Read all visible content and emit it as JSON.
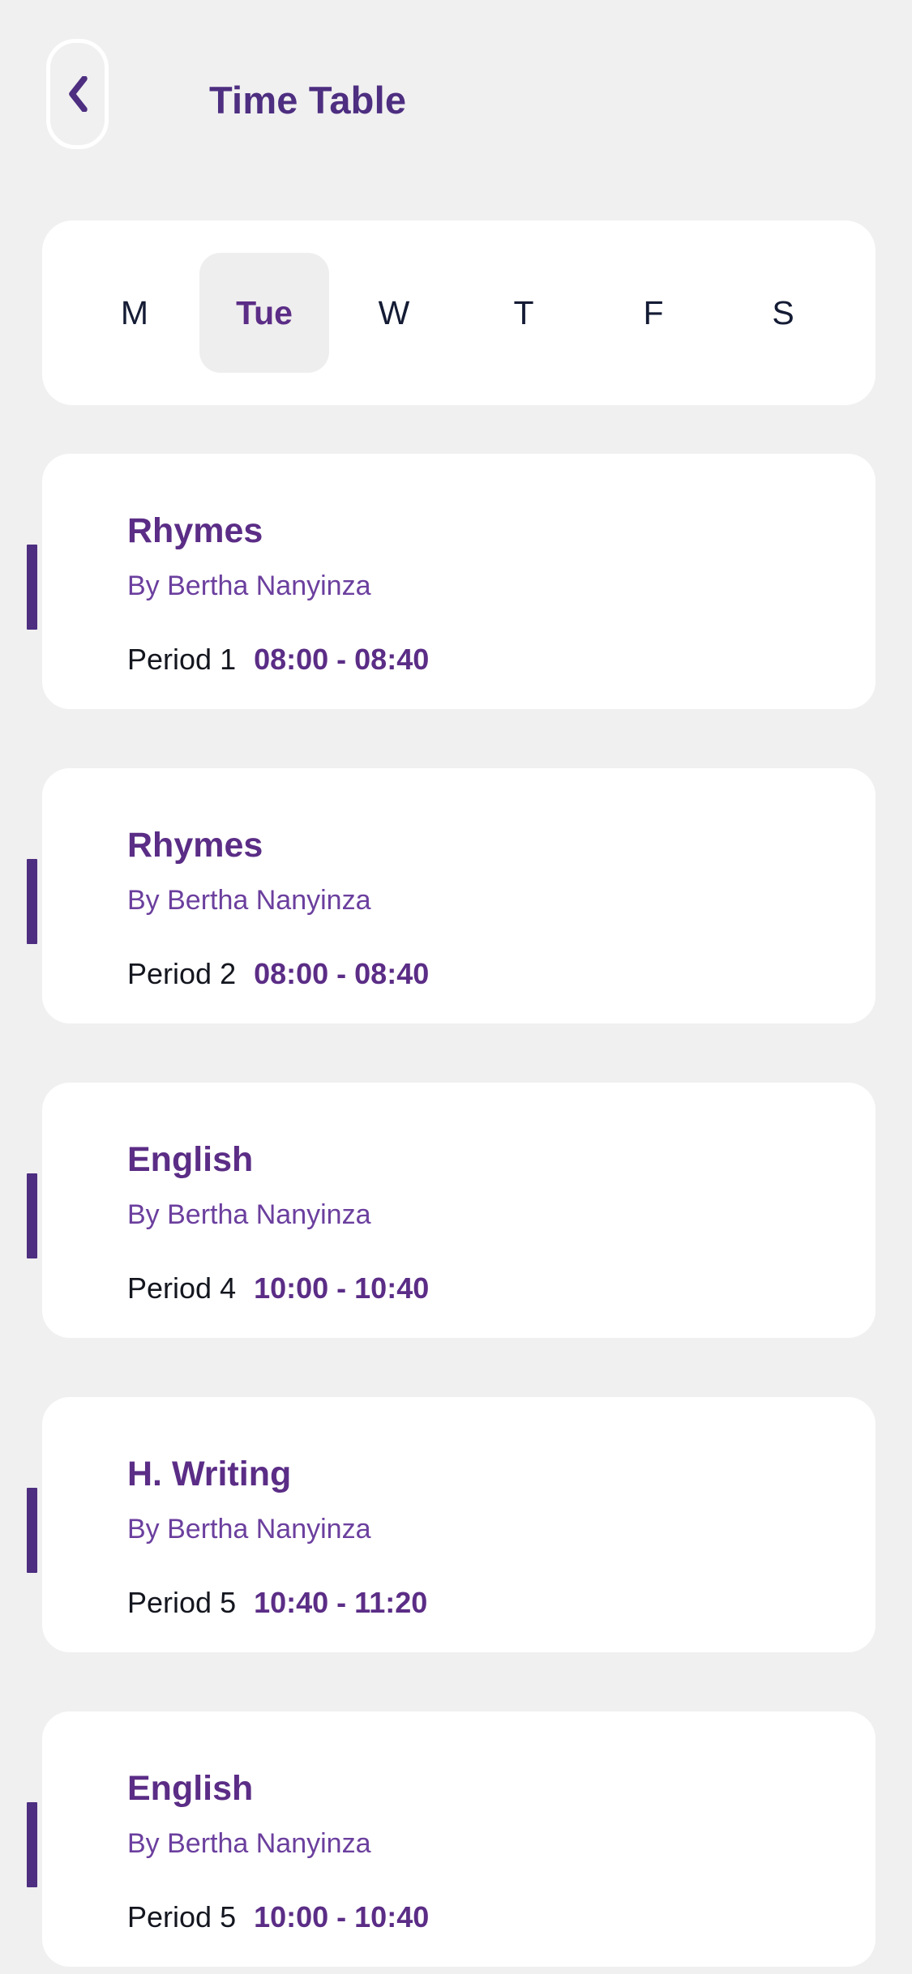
{
  "theme": {
    "background": "#f0f0f0",
    "card_background": "#ffffff",
    "accent_purple": "#4d2e80",
    "title_purple": "#5b2d86",
    "teacher_purple": "#6b3f9e",
    "day_text": "#141b34",
    "selected_day_background": "#efeeee",
    "period_text": "#14161f"
  },
  "header": {
    "title": "Time Table",
    "back_icon": "chevron-left-icon"
  },
  "day_selector": {
    "selected": "Tue",
    "days": [
      {
        "label": "M",
        "selected": false
      },
      {
        "label": "Tue",
        "selected": true
      },
      {
        "label": "W",
        "selected": false
      },
      {
        "label": "T",
        "selected": false
      },
      {
        "label": "F",
        "selected": false
      },
      {
        "label": "S",
        "selected": false
      }
    ]
  },
  "classes": [
    {
      "subject": "Rhymes",
      "teacher": "By Bertha Nanyinza",
      "period": "Period 1",
      "time": "08:00 - 08:40"
    },
    {
      "subject": "Rhymes",
      "teacher": "By Bertha Nanyinza",
      "period": "Period 2",
      "time": "08:00 - 08:40"
    },
    {
      "subject": "English",
      "teacher": "By Bertha Nanyinza",
      "period": "Period 4",
      "time": "10:00 - 10:40"
    },
    {
      "subject": "H. Writing",
      "teacher": "By Bertha Nanyinza",
      "period": "Period 5",
      "time": "10:40 - 11:20"
    },
    {
      "subject": "English",
      "teacher": "By Bertha Nanyinza",
      "period": "Period 5",
      "time": "10:00 - 10:40"
    }
  ]
}
